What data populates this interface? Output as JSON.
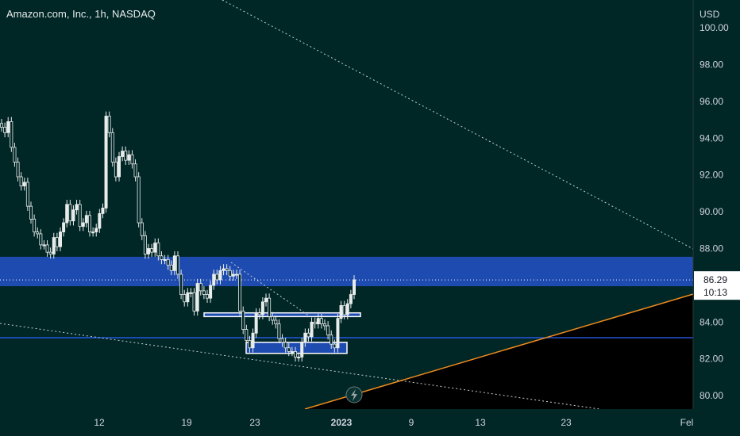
{
  "header": {
    "symbol_title": "Amazon.com, Inc., 1h, NASDAQ"
  },
  "price_axis": {
    "currency": "USD",
    "current_price": "86.29",
    "countdown": "10:13"
  },
  "colors": {
    "background": "#002626",
    "candle": "#e8ecea",
    "zone": "#1e4bb0",
    "support_line": "#2962ff",
    "orange_trendline": "#f08c1e",
    "dotted": "#c7cfcf",
    "price_label_bg": "#ffffff"
  },
  "icons": {
    "flash": "lightning-icon"
  },
  "chart_data": {
    "type": "candlestick",
    "title": "Amazon.com, Inc., 1h, NASDAQ",
    "ylabel": "USD",
    "ylim": [
      79.3,
      101.2
    ],
    "y_ticks": [
      "80.00",
      "82.00",
      "84.00",
      "86.00",
      "88.00",
      "90.00",
      "92.00",
      "94.00",
      "96.00",
      "98.00",
      "100.00"
    ],
    "x_ticks": [
      "12",
      "19",
      "23",
      "2023",
      "9",
      "13",
      "23",
      "Fel"
    ],
    "grid": false,
    "last_price": 86.29,
    "resistance_zone": [
      85.95,
      87.55
    ],
    "support_level": 83.15,
    "consolidation_boxes": [
      [
        84.3,
        84.5
      ],
      [
        82.3,
        82.9
      ]
    ],
    "series": [
      {
        "values": [
          94.6,
          94.3,
          94.9,
          93.5,
          92.7,
          91.9,
          91.4,
          91.6,
          90.3,
          89.6,
          88.9,
          88.8,
          88.2,
          88.2,
          87.8,
          87.7,
          88.6,
          88.1,
          88.9,
          89.4,
          90.4,
          89.5,
          90.1,
          90.4,
          89.2,
          89.4,
          89.8,
          88.9,
          88.9,
          89.1,
          89.9,
          90.2,
          95.2,
          94.3,
          92.7,
          91.9,
          93.0,
          93.3,
          92.8,
          93.1,
          92.6,
          91.9,
          89.4,
          88.7,
          87.7,
          88.0,
          87.8,
          88.3,
          87.6,
          87.4,
          87.4,
          87.1,
          86.8,
          87.6,
          86.6,
          85.5,
          85.1,
          85.6,
          85.6,
          84.6,
          86.1,
          85.7,
          85.5,
          85.3,
          86.0,
          86.6,
          86.3,
          86.8,
          86.9,
          86.8,
          86.5,
          86.6,
          86.6,
          84.6,
          83.6,
          83.0,
          82.6,
          83.4,
          84.5,
          84.4,
          85.1,
          85.3,
          84.3,
          84.1,
          83.9,
          83.1,
          82.9,
          82.6,
          82.4,
          82.4,
          82.1,
          82.1,
          82.9,
          83.4,
          83.2,
          84.0,
          83.9,
          84.2,
          83.9,
          83.8,
          83.3,
          82.8,
          82.6,
          84.2,
          84.9,
          84.4,
          85.0,
          85.5,
          86.3
        ]
      }
    ]
  }
}
